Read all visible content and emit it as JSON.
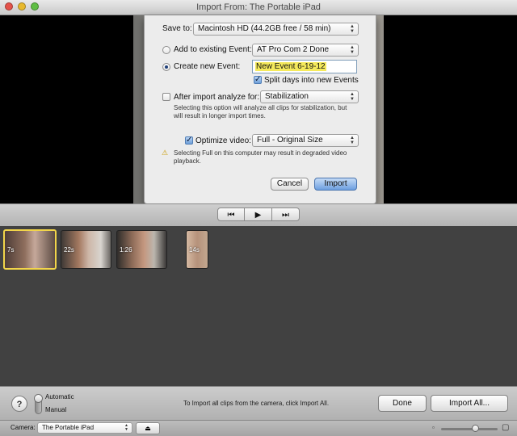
{
  "window": {
    "title": "Import From: The Portable iPad"
  },
  "sheet": {
    "save_to_label": "Save to:",
    "save_to_value": "Macintosh HD (44.2GB free / 58 min)",
    "add_existing_label": "Add to existing Event:",
    "existing_event_value": "AT Pro Com 2 Done",
    "create_new_label": "Create new Event:",
    "new_event_name": "New Event 6-19-12",
    "split_days_label": "Split days into new Events",
    "analyze_label": "After import analyze for:",
    "analyze_value": "Stabilization",
    "analyze_note_1": "Selecting this option will analyze all clips for stabilization, but",
    "analyze_note_2": "will result in longer import times.",
    "optimize_label": "Optimize video:",
    "optimize_value": "Full - Original Size",
    "warning_1": "Selecting Full on this computer may result in degraded video",
    "warning_2": "playback.",
    "cancel_label": "Cancel",
    "import_label": "Import",
    "state": {
      "add_existing": false,
      "create_new": true,
      "split_days": true,
      "analyze": false,
      "optimize": true
    }
  },
  "transport": {
    "prev": "⏮",
    "play": "▶",
    "next": "⏭"
  },
  "clips": [
    {
      "duration": "7s",
      "selected": true
    },
    {
      "duration": "22s",
      "selected": false
    },
    {
      "duration": "1:26",
      "selected": false
    },
    {
      "duration": "14s",
      "selected": false
    }
  ],
  "bottom": {
    "help": "?",
    "mode_automatic": "Automatic",
    "mode_manual": "Manual",
    "hint": "To Import all clips from the camera, click Import All.",
    "done_label": "Done",
    "import_all_label": "Import All..."
  },
  "status": {
    "camera_label": "Camera:",
    "camera_value": "The Portable iPad",
    "eject": "⏏",
    "zoom_level": 0.6
  },
  "colors": {
    "highlight": "#f2d54a",
    "accent": "#6d9fe0"
  }
}
